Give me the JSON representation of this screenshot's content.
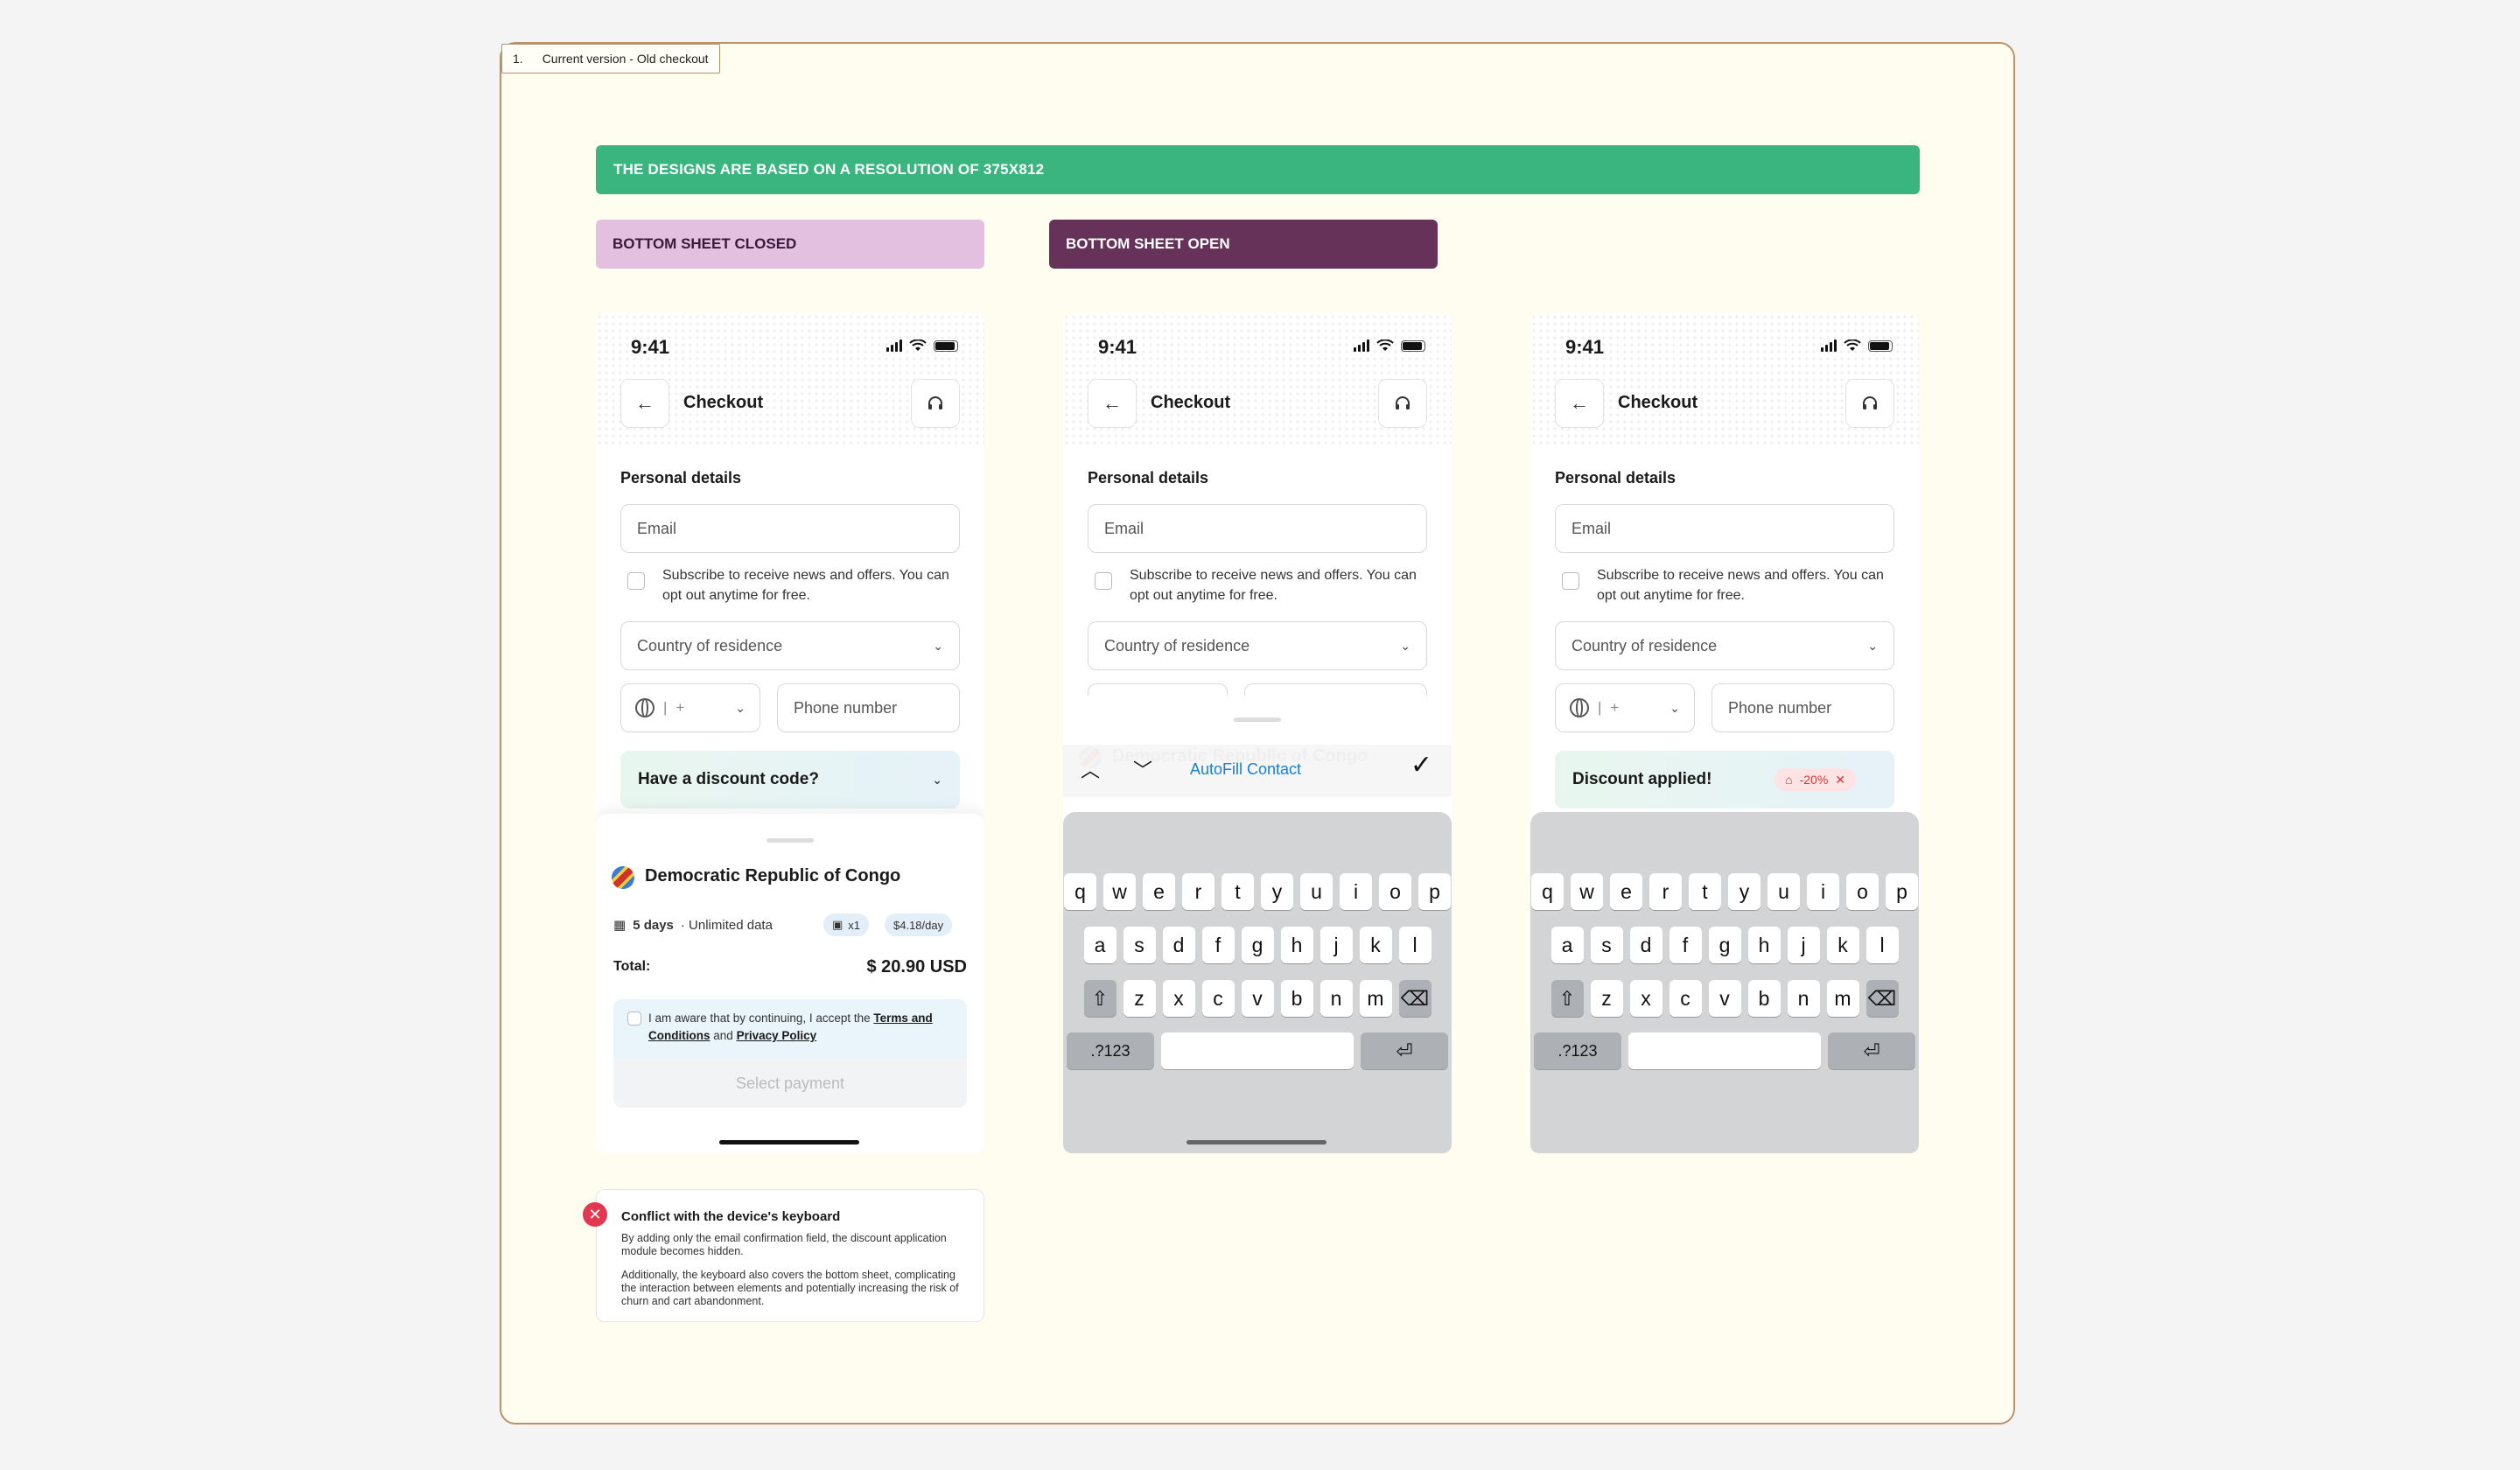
{
  "frame": {
    "index": "1.",
    "title": "Current version - Old checkout"
  },
  "banner": "THE DESIGNS ARE BASED ON A RESOLUTION OF 375X812",
  "labels": {
    "closed": "BOTTOM SHEET CLOSED",
    "open": "BOTTOM SHEET OPEN"
  },
  "screen": {
    "time": "9:41",
    "title": "Checkout",
    "back_icon": "arrow-left-icon",
    "support_icon": "headset-icon",
    "section": "Personal details",
    "email_placeholder": "Email",
    "subscribe": "Subscribe to receive news and offers. You can opt out anytime for free.",
    "country_placeholder": "Country of residence",
    "prefix": "+",
    "phone_placeholder": "Phone number",
    "discount": "Have a discount code?",
    "discount_applied": "Discount applied!",
    "discount_badge": "-20%"
  },
  "sheet": {
    "destination": "Democratic Republic of Congo",
    "duration": "5 days",
    "data": "· Unlimited data",
    "qty": "x1",
    "rate": "$4.18/day",
    "total_label": "Total:",
    "total_value": "$ 20.90 USD",
    "terms_pre": "I am aware that by continuing, I accept the",
    "terms_link": "Terms and Conditions",
    "terms_and": "and",
    "privacy_link": "Privacy Policy",
    "pay": "Select payment"
  },
  "keyboard": {
    "row1": [
      "q",
      "w",
      "e",
      "r",
      "t",
      "y",
      "u",
      "i",
      "o",
      "p"
    ],
    "row2": [
      "a",
      "s",
      "d",
      "f",
      "g",
      "h",
      "j",
      "k",
      "l"
    ],
    "row3": [
      "z",
      "x",
      "c",
      "v",
      "b",
      "n",
      "m"
    ],
    "num": ".?123",
    "autofill": "AutoFill Contact"
  },
  "note": {
    "title": "Conflict with the device's keyboard",
    "p1": "By adding only the email confirmation field, the discount application module becomes hidden.",
    "p2": "Additionally, the keyboard also covers the bottom sheet, complicating the interaction between elements and potentially increasing the risk of churn and cart abandonment."
  },
  "colors": {
    "banner": "#3ab57f",
    "closed": "#e3bfe0",
    "open": "#66325a",
    "error": "#e2374e",
    "link": "#1a7fd6"
  }
}
